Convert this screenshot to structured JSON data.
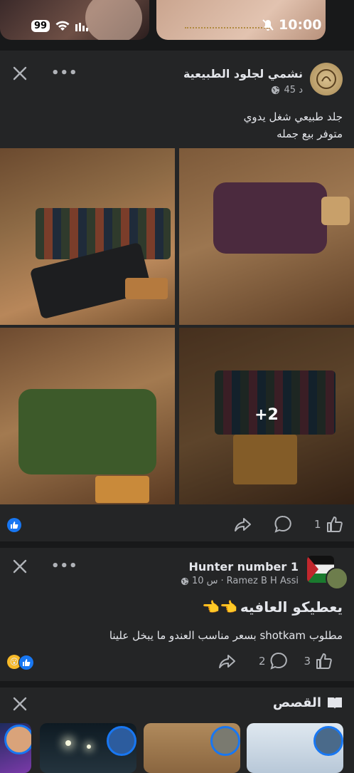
{
  "status_bar": {
    "battery": "99",
    "time": "10:00"
  },
  "post1": {
    "page_name": "نشمي لجلود الطبيعية",
    "time": "45 د",
    "text_line1": "جلد طبيعي شغل يدوي",
    "text_line2": "متوفر بيع جمله",
    "more_photos": "+2",
    "like_count": "1"
  },
  "post2": {
    "group_name": "Hunter number 1",
    "author": "Ramez B H Assi",
    "time": "10 س",
    "headline": "يعطيكو العافيه",
    "headline_emoji": "👈👈",
    "body": "مطلوب shotkam بسعر مناسب  العندو ما يبخل علينا",
    "like_count": "3",
    "comment_count": "2"
  },
  "stories": {
    "title": "القصص"
  },
  "colors": {
    "background": "#242526",
    "separator": "#18191a",
    "accent": "#1877f2",
    "text": "#e4e6eb",
    "muted": "#b0b3b8"
  },
  "icons": [
    "close-icon",
    "more-icon",
    "globe-icon",
    "like-icon",
    "comment-icon",
    "share-icon",
    "book-icon",
    "wifi-icon",
    "signal-icon",
    "mute-icon"
  ]
}
